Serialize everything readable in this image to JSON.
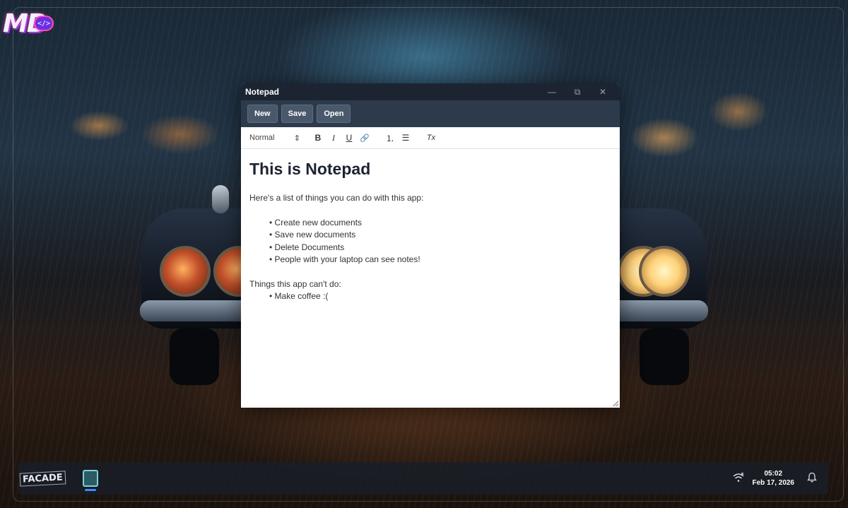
{
  "logo": {
    "text": "MD",
    "badge": "</>"
  },
  "window": {
    "title": "Notepad",
    "controls": {
      "minimize": "—",
      "maximize": "⧉",
      "close": "✕"
    }
  },
  "toolbar": {
    "new_label": "New",
    "save_label": "Save",
    "open_label": "Open"
  },
  "format": {
    "style_select": "Normal",
    "bold": "B",
    "italic": "I",
    "underline": "U",
    "link": "🔗",
    "ordered_list": "⒈",
    "bullet_list": "☰",
    "clear_format": "Tx"
  },
  "document": {
    "heading": "This is Notepad",
    "intro": "Here's a list of things you can do with this app:",
    "can_do": [
      "Create new documents",
      "Save new documents",
      "Delete Documents",
      "People with your laptop can see notes!"
    ],
    "cant_intro": "Things this app can't do:",
    "cant_do": [
      "Make coffee :("
    ]
  },
  "taskbar": {
    "facade_label": "FACADE",
    "time": "05:02",
    "date": "Feb 17, 2026"
  },
  "icons": {
    "wifi": "wifi-off-icon",
    "bell": "bell-icon"
  }
}
